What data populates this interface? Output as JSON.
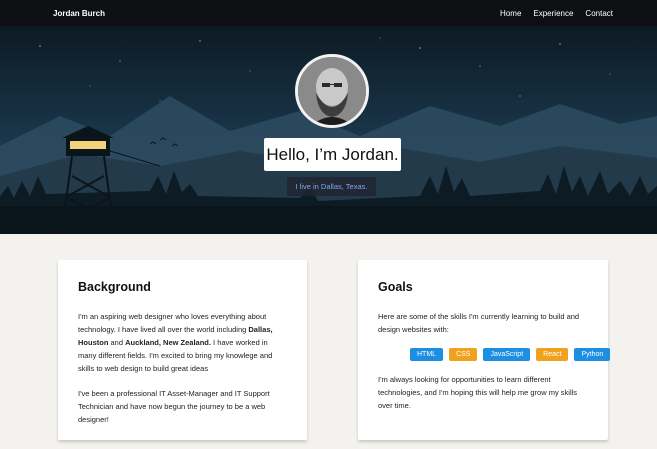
{
  "nav": {
    "brand": "Jordan Burch",
    "links": [
      "Home",
      "Experience",
      "Contact"
    ]
  },
  "hero": {
    "title": "Hello, I’m Jordan.",
    "subtitle": "I live in Dallas, Texas."
  },
  "background_card": {
    "heading": "Background",
    "p1_a": "I'm an aspiring web designer who loves everything about technology. I have lived all over the world including ",
    "p1_b1": "Dallas, Houston",
    "p1_c": " and ",
    "p1_b2": "Auckland, New Zealand.",
    "p1_d": " I have worked in many different fields. I'm excited to bring my knowlege and skills to web design to build great ideas",
    "p2": "I've been a professional IT Asset-Manager and IT Support Technician and have now begun the journey to be a web designer!"
  },
  "goals_card": {
    "heading": "Goals",
    "p1": "Here are some of the skills I'm currently learning to build and design websites with:",
    "skills": [
      "HTML",
      "CSS",
      "JavaScript",
      "React",
      "Python"
    ],
    "p2": "I'm always looking for opportunities to learn different technologies, and I'm hoping this will help me grow my skills over time."
  },
  "colors": {
    "chip_blue": "#1c8fe3",
    "chip_orange": "#f0a21f",
    "navbar": "#0d0f13",
    "page_bg": "#f4f2ee"
  }
}
